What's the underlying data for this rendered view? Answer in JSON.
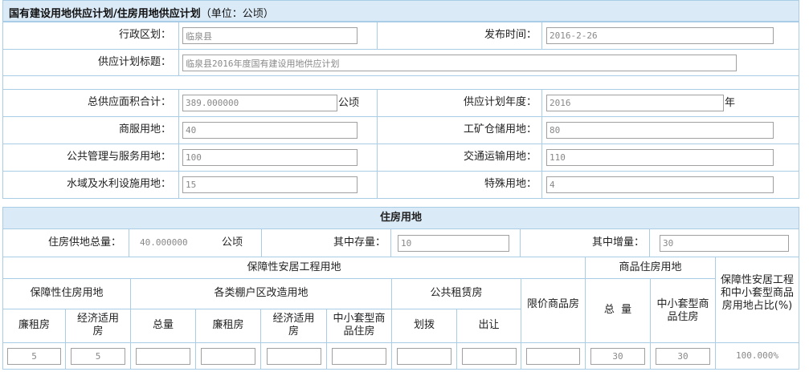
{
  "header": {
    "title": "国有建设用地供应计划/住房用地供应计划",
    "unit_note": "（单位：公顷）"
  },
  "form": {
    "district_label": "行政区划：",
    "district_value": "临泉县",
    "publish_time_label": "发布时间：",
    "publish_time_value": "2016-2-26",
    "plan_title_label": "供应计划标题：",
    "plan_title_value": "临泉县2016年度国有建设用地供应计划",
    "total_area_label": "总供应面积合计：",
    "total_area_value": "389.000000",
    "total_area_unit": "公顷",
    "plan_year_label": "供应计划年度：",
    "plan_year_value": "2016",
    "plan_year_unit": "年",
    "commercial_label": "商服用地：",
    "commercial_value": "40",
    "industrial_label": "工矿仓储用地：",
    "industrial_value": "80",
    "public_label": "公共管理与服务用地：",
    "public_value": "100",
    "transport_label": "交通运输用地：",
    "transport_value": "110",
    "water_label": "水域及水利设施用地：",
    "water_value": "15",
    "special_label": "特殊用地：",
    "special_value": "4"
  },
  "housing": {
    "section_title": "住房用地",
    "total_label": "住房供地总量：",
    "total_value": "40.000000",
    "total_unit": "公顷",
    "stock_label": "其中存量：",
    "stock_value": "10",
    "increment_label": "其中增量：",
    "increment_value": "30",
    "table": {
      "group_affordable": "保障性安居工程用地",
      "group_commercial": "商品住房用地",
      "ratio_header": "保障性安居工程和中小套型商品房用地占比(%)",
      "sub_affordable_housing": "保障性住房用地",
      "sub_shantytown": "各类棚户区改造用地",
      "sub_public_rental": "公共租赁房",
      "price_limited": "限价商品房",
      "col_low_rent": "廉租房",
      "col_economic": "经济适用房",
      "col_total": "总量",
      "col_low_rent_2": "廉租房",
      "col_economic_2": "经济适用房",
      "col_small_commercial": "中小套型商品住房",
      "col_allocation": "划拨",
      "col_transfer": "出让",
      "col_comm_total": "总  量",
      "col_comm_small": "中小套型商品住房",
      "row_values": [
        "5",
        "5",
        "",
        "",
        "",
        "",
        "",
        "",
        "",
        "30",
        "30"
      ],
      "ratio_value": "100.000%"
    }
  }
}
